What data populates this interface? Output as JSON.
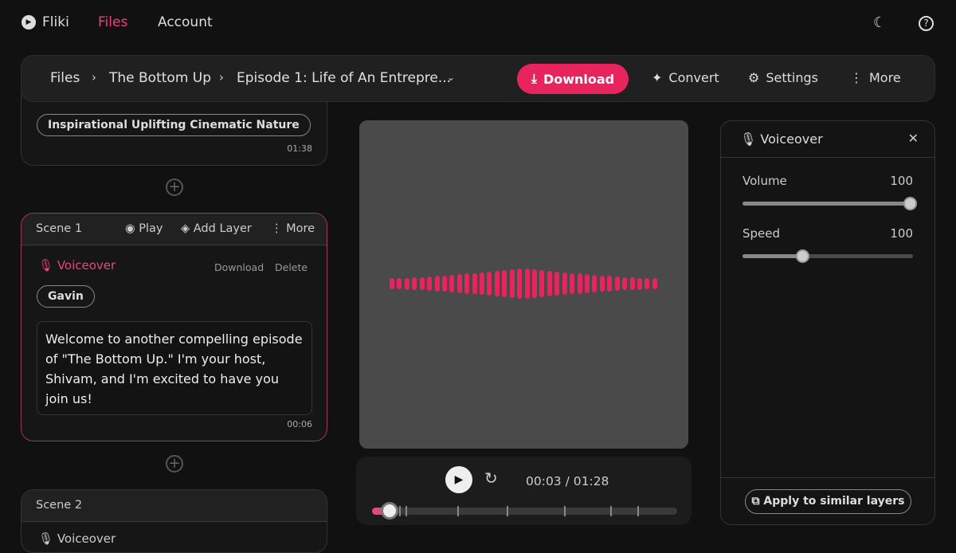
{
  "nav": {
    "logo": "Fliki",
    "items": [
      {
        "label": "Files",
        "active": true
      },
      {
        "label": "Account",
        "active": false
      }
    ],
    "icons": [
      "moon-icon",
      "help-icon"
    ]
  },
  "breadcrumb": [
    "Files",
    "The Bottom Up",
    "Episode 1: Life of An Entrepre..."
  ],
  "toolbar": {
    "download": "Download",
    "convert": "Convert",
    "settings": "Settings",
    "more": "More"
  },
  "music_card": {
    "chip": "Inspirational Uplifting Cinematic Nature",
    "duration": "01:38"
  },
  "scene1": {
    "title": "Scene 1",
    "play": "Play",
    "add_layer": "Add Layer",
    "more": "More",
    "layer": "Voiceover",
    "download": "Download",
    "delete": "Delete",
    "voice": "Gavin",
    "text": "Welcome to another compelling episode of \"The Bottom Up.\" I'm your host, Shivam, and I'm excited to have you join us!",
    "duration": "00:06"
  },
  "scene2": {
    "title": "Scene 2",
    "layer": "Voiceover"
  },
  "player": {
    "time": "00:03 / 01:28",
    "progress_percent": 3
  },
  "voiceover_panel": {
    "title": "Voiceover",
    "volume_label": "Volume",
    "volume": 100,
    "speed_label": "Speed",
    "speed": 100,
    "speed_fill_percent": 35,
    "apply": "Apply to similar layers"
  },
  "colors": {
    "accent": "#e8245f",
    "bg": "#111111"
  }
}
